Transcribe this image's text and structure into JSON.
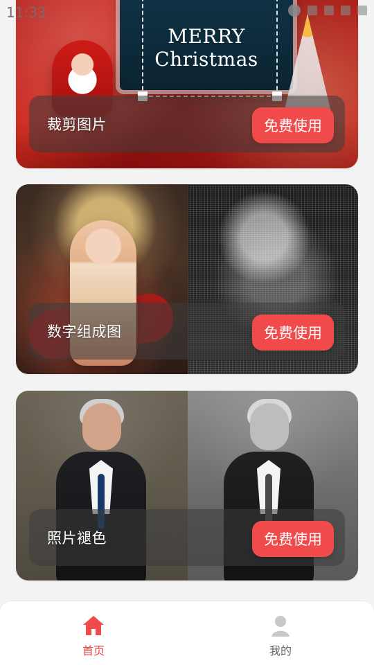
{
  "status_bar": {
    "time": "11:33"
  },
  "cards": [
    {
      "title": "裁剪图片",
      "button": "免费使用",
      "image_text": {
        "line1": "MERRY",
        "line2": "Christmas"
      }
    },
    {
      "title": "数字组成图",
      "button": "免费使用"
    },
    {
      "title": "照片褪色",
      "button": "免费使用"
    }
  ],
  "bottom_nav": {
    "items": [
      {
        "label": "首页",
        "icon": "home-icon",
        "active": true
      },
      {
        "label": "我的",
        "icon": "user-icon",
        "active": false
      }
    ]
  },
  "colors": {
    "accent": "#f04a4a",
    "active_nav": "#e34343"
  }
}
